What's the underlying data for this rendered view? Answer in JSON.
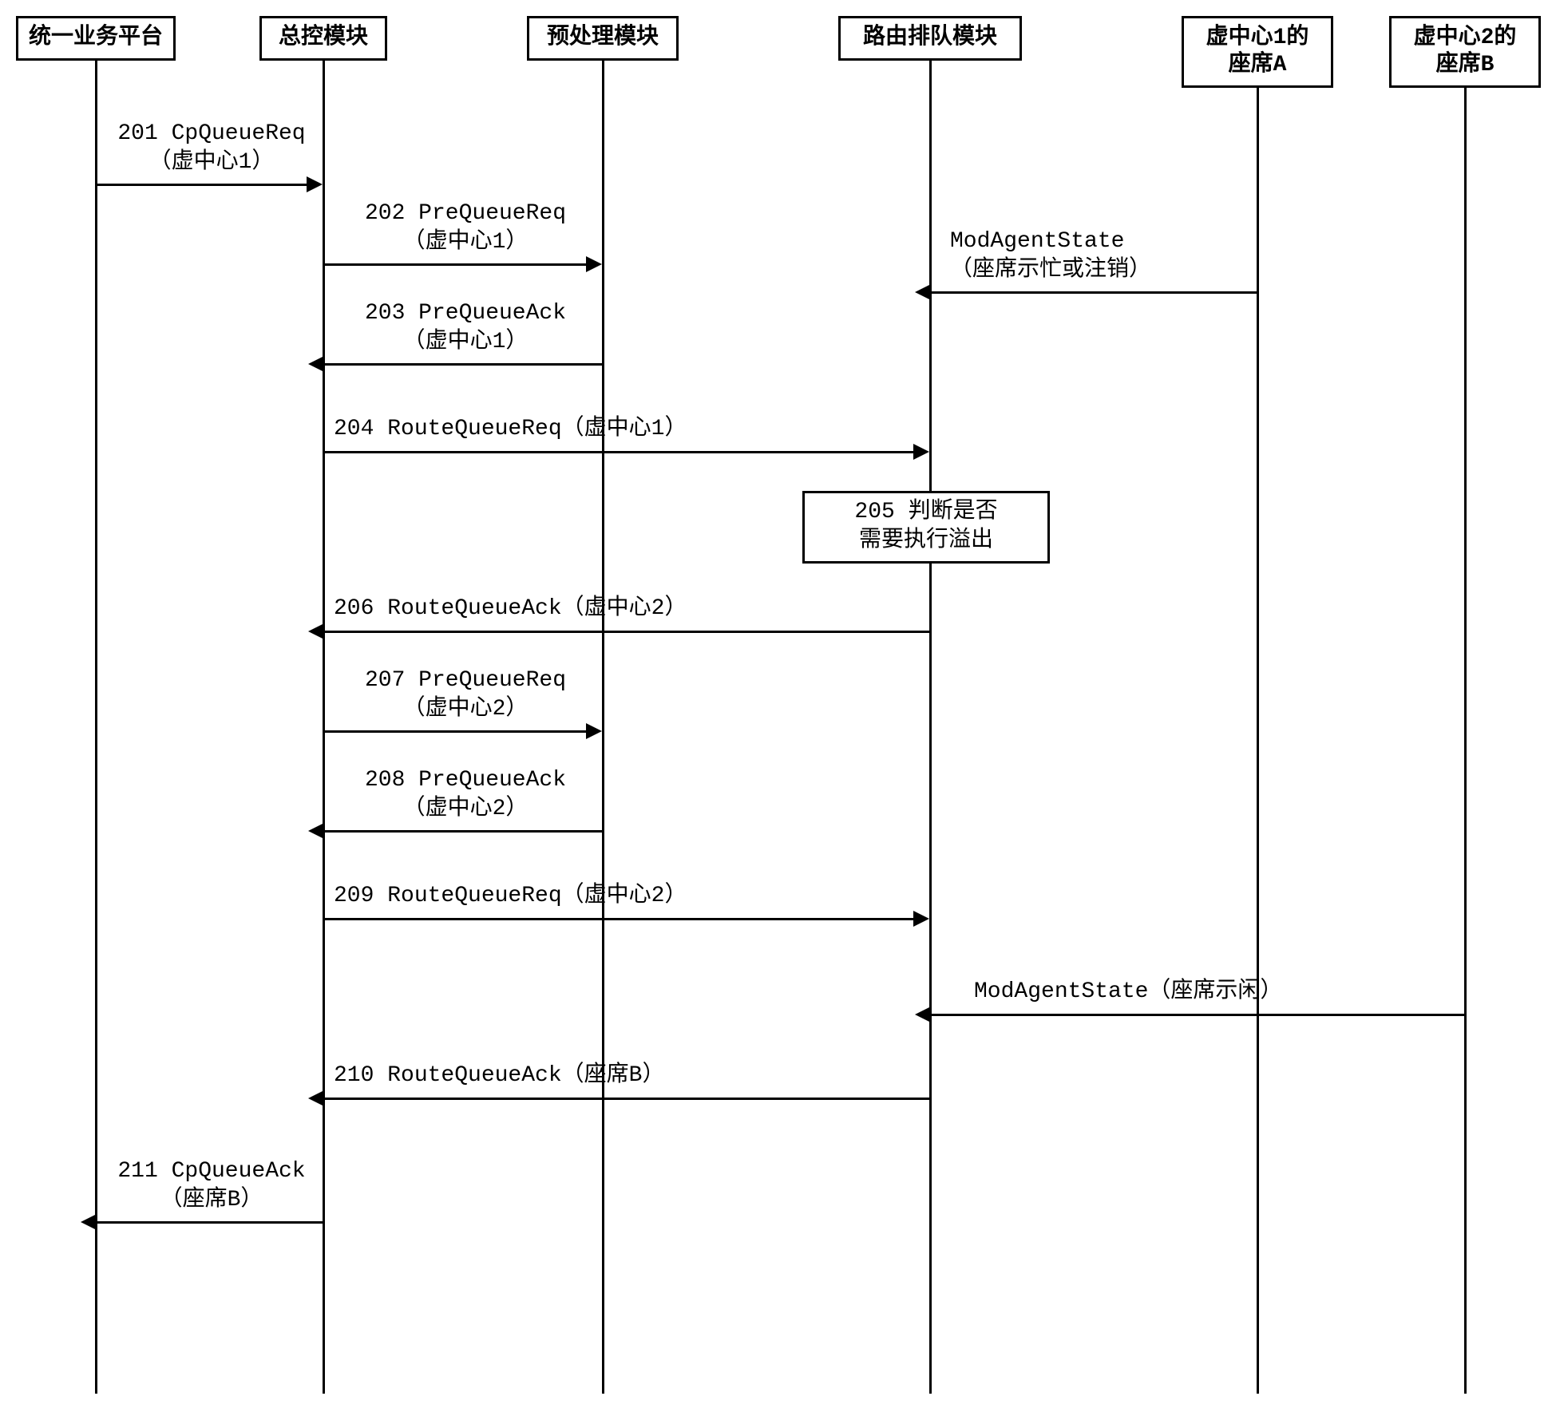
{
  "participants": {
    "p1": "统一业务平台",
    "p2": "总控模块",
    "p3": "预处理模块",
    "p4": "路由排队模块",
    "p5": "虚中心1的\n座席A",
    "p6": "虚中心2的\n座席B"
  },
  "messages": {
    "m201": "201 CpQueueReq\n（虚中心1）",
    "m202": "202 PreQueueReq\n（虚中心1）",
    "mA": "ModAgentState\n（座席示忙或注销）",
    "m203": "203 PreQueueAck\n（虚中心1）",
    "m204": "204 RouteQueueReq（虚中心1）",
    "m205": "205 判断是否\n需要执行溢出",
    "m206": "206 RouteQueueAck（虚中心2）",
    "m207": "207 PreQueueReq\n（虚中心2）",
    "m208": "208 PreQueueAck\n（虚中心2）",
    "m209": "209 RouteQueueReq（虚中心2）",
    "mB": "ModAgentState（座席示闲）",
    "m210": "210 RouteQueueAck（座席B）",
    "m211": "211 CpQueueAck\n（座席B）"
  }
}
